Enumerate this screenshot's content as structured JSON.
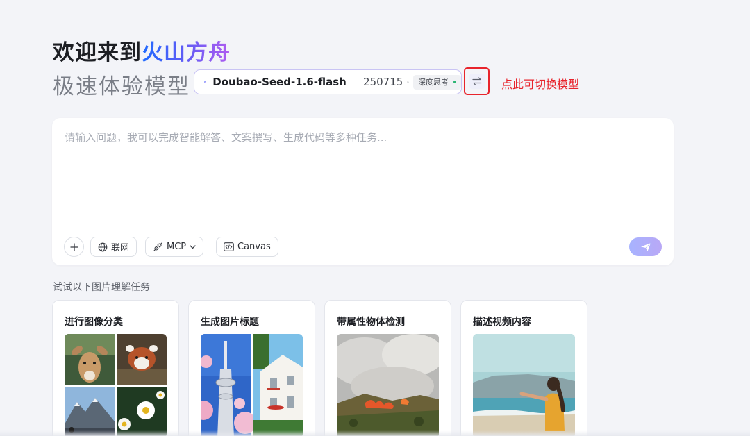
{
  "header": {
    "welcome_prefix": "欢迎来到",
    "welcome_brand": "火山方舟",
    "subtitle": "极速体验模型"
  },
  "model_selector": {
    "name": "Doubao-Seed-1.6-flash",
    "version": "250715",
    "badge": "深度思考",
    "switch_hint": "点此可切换模型"
  },
  "chat": {
    "placeholder": "请输入问题，我可以完成智能解答、文案撰写、生成代码等多种任务...",
    "tools": {
      "web_label": "联网",
      "mcp_label": "MCP",
      "canvas_label": "Canvas"
    }
  },
  "suggestions": {
    "section_label": "试试以下图片理解任务",
    "cards": [
      {
        "title": "进行图像分类"
      },
      {
        "title": "生成图片标题"
      },
      {
        "title": "带属性物体检测"
      },
      {
        "title": "描述视频内容"
      }
    ]
  },
  "colors": {
    "accent_red": "#e8242c",
    "brand_gradient_start": "#1f6bff",
    "brand_gradient_end": "#b15cf0",
    "send_button": "#a7b3ff"
  },
  "icons": [
    "model-logo-icon",
    "info-icon",
    "swap-icon",
    "plus-icon",
    "globe-icon",
    "plug-icon",
    "chevron-down-icon",
    "code-icon",
    "send-icon"
  ]
}
